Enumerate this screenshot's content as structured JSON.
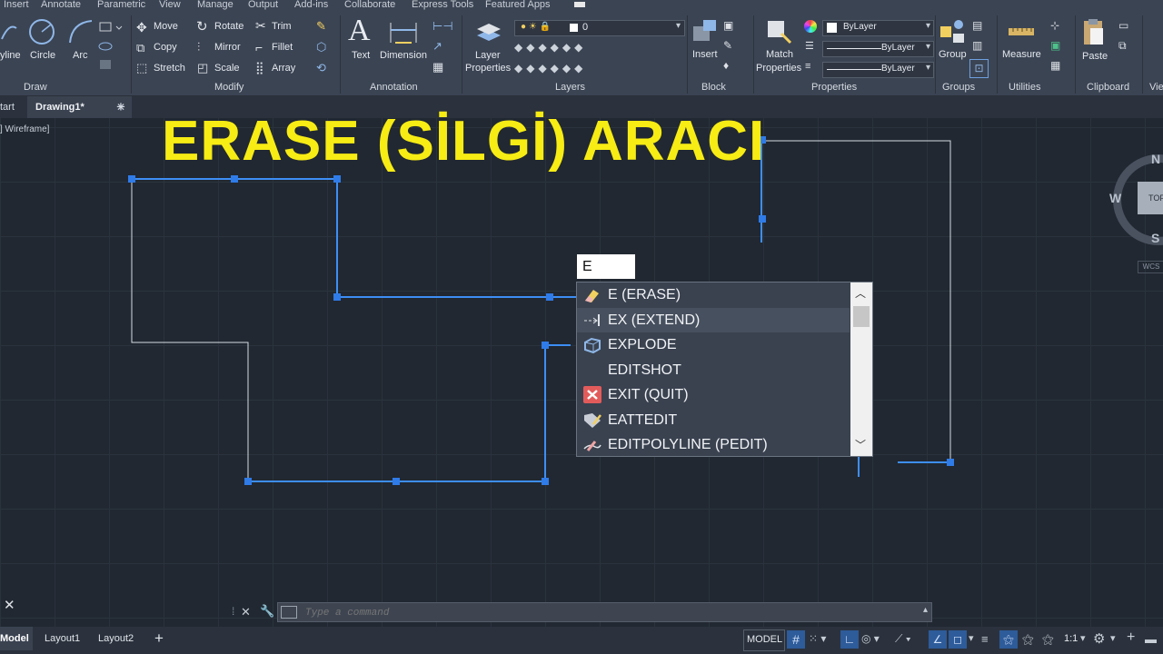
{
  "menu": {
    "items": [
      "Insert",
      "Annotate",
      "Parametric",
      "View",
      "Manage",
      "Output",
      "Add-ins",
      "Collaborate",
      "Express Tools",
      "Featured Apps"
    ]
  },
  "ribbon": {
    "draw": {
      "title": "Draw",
      "polyline": "yline",
      "circle": "Circle",
      "arc": "Arc"
    },
    "modify": {
      "title": "Modify",
      "move": "Move",
      "rotate": "Rotate",
      "trim": "Trim",
      "copy": "Copy",
      "mirror": "Mirror",
      "fillet": "Fillet",
      "stretch": "Stretch",
      "scale": "Scale",
      "array": "Array"
    },
    "annotation": {
      "title": "Annotation",
      "text": "Text",
      "dimension": "Dimension"
    },
    "layers": {
      "title": "Layers",
      "layer_properties_1": "Layer",
      "layer_properties_2": "Properties",
      "current_layer": "0"
    },
    "block": {
      "title": "Block",
      "insert": "Insert"
    },
    "properties": {
      "title": "Properties",
      "match_1": "Match",
      "match_2": "Properties",
      "color": "ByLayer",
      "linetype": "ByLayer",
      "lineweight": "ByLayer"
    },
    "groups": {
      "title": "Groups",
      "group": "Group"
    },
    "utilities": {
      "title": "Utilities",
      "measure": "Measure"
    },
    "clipboard": {
      "title": "Clipboard",
      "paste": "Paste"
    },
    "view_partial": "Vie"
  },
  "tabs": {
    "start": "tart",
    "drawing": "Drawing1*",
    "add": "+"
  },
  "viewport": {
    "label": "] Wireframe]",
    "headline": "ERASE (SİLGİ) ARACI"
  },
  "viewcube": {
    "n": "N",
    "w": "W",
    "s": "S",
    "top": "TOP",
    "wcs": "WCS"
  },
  "command": {
    "typed": "E",
    "autocomplete": [
      {
        "label": "E (ERASE)",
        "icon": "eraser-icon"
      },
      {
        "label": "EX (EXTEND)",
        "icon": "extend-icon"
      },
      {
        "label": "EXPLODE",
        "icon": "explode-icon"
      },
      {
        "label": "EDITSHOT",
        "icon": ""
      },
      {
        "label": "EXIT (QUIT)",
        "icon": "exit-icon"
      },
      {
        "label": "EATTEDIT",
        "icon": "attribute-edit-icon"
      },
      {
        "label": "EDITPOLYLINE (PEDIT)",
        "icon": "pedit-icon"
      }
    ],
    "placeholder": "Type a command"
  },
  "status": {
    "tabs": [
      "Model",
      "Layout1",
      "Layout2"
    ],
    "model_label": "MODEL",
    "scale": "1:1"
  },
  "colors": {
    "headline": "#f7ec14",
    "selection": "#2f7be8",
    "background": "#212830"
  }
}
